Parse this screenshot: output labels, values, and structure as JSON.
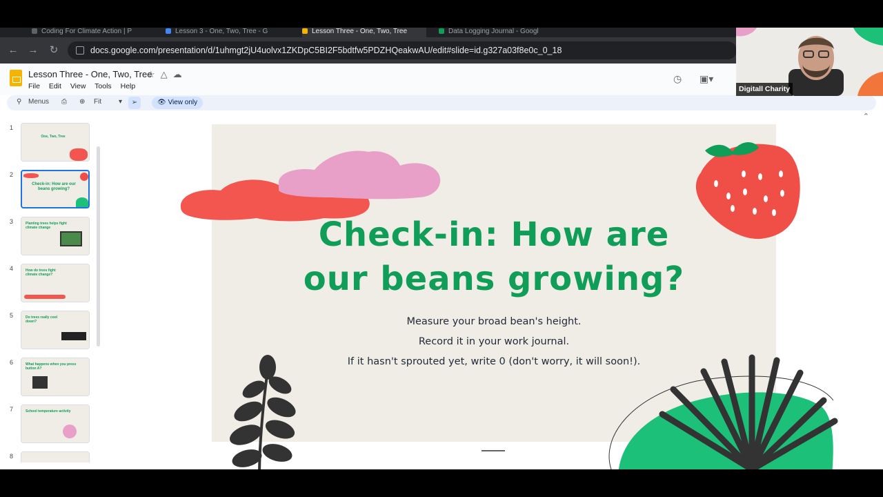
{
  "browser": {
    "tabs": [
      {
        "label": "Coding For Climate Action | P",
        "color": "#5f6368"
      },
      {
        "label": "Lesson 3 - One, Two, Tree - G",
        "color": "#4285f4"
      },
      {
        "label": "Lesson Three - One, Two, Tree",
        "color": "#f4b400"
      },
      {
        "label": "Data Logging Journal - Googl",
        "color": "#0f9d58"
      }
    ],
    "url": "docs.google.com/presentation/d/1uhmgt2jU4uolvx1ZKDpC5BI2F5bdtfw5PDZHQeakwAU/edit#slide=id.g327a03f8e0c_0_18"
  },
  "app": {
    "doc_title": "Lesson Three - One, Two, Tree",
    "menu": [
      "File",
      "Edit",
      "View",
      "Tools",
      "Help"
    ]
  },
  "toolbar": {
    "menus_label": "Menus",
    "zoom_label": "Fit",
    "view_only_label": "View only"
  },
  "filmstrip": {
    "slides": [
      {
        "num": "1",
        "title": "One, Two, Tree"
      },
      {
        "num": "2",
        "title": "Check-in: How are our beans growing?"
      },
      {
        "num": "3",
        "title": "Planting trees helps fight climate change"
      },
      {
        "num": "4",
        "title": "How do trees fight climate change?"
      },
      {
        "num": "5",
        "title": "Do trees really cool down?"
      },
      {
        "num": "6",
        "title": "What happens when you press button A?"
      },
      {
        "num": "7",
        "title": "School temperature activity"
      },
      {
        "num": "8",
        "title": ""
      }
    ],
    "selected_index": 1
  },
  "slide": {
    "title_line1": "Check-in: How are",
    "title_line2": "our beans growing?",
    "body": [
      "Measure your broad bean's height.",
      "Record it in your work journal.",
      "If it hasn't sprouted yet, write 0 (don't worry, it will soon!)."
    ]
  },
  "webcam": {
    "name": "Digitall Charity"
  },
  "colors": {
    "slide_green": "#0f9d58",
    "slide_bg": "#f0ede6",
    "cloud_red": "#f2564f",
    "cloud_pink": "#e8a0c8",
    "strawberry": "#ef4f47",
    "leaf_dark": "#333333",
    "blob_green": "#1cc078"
  }
}
